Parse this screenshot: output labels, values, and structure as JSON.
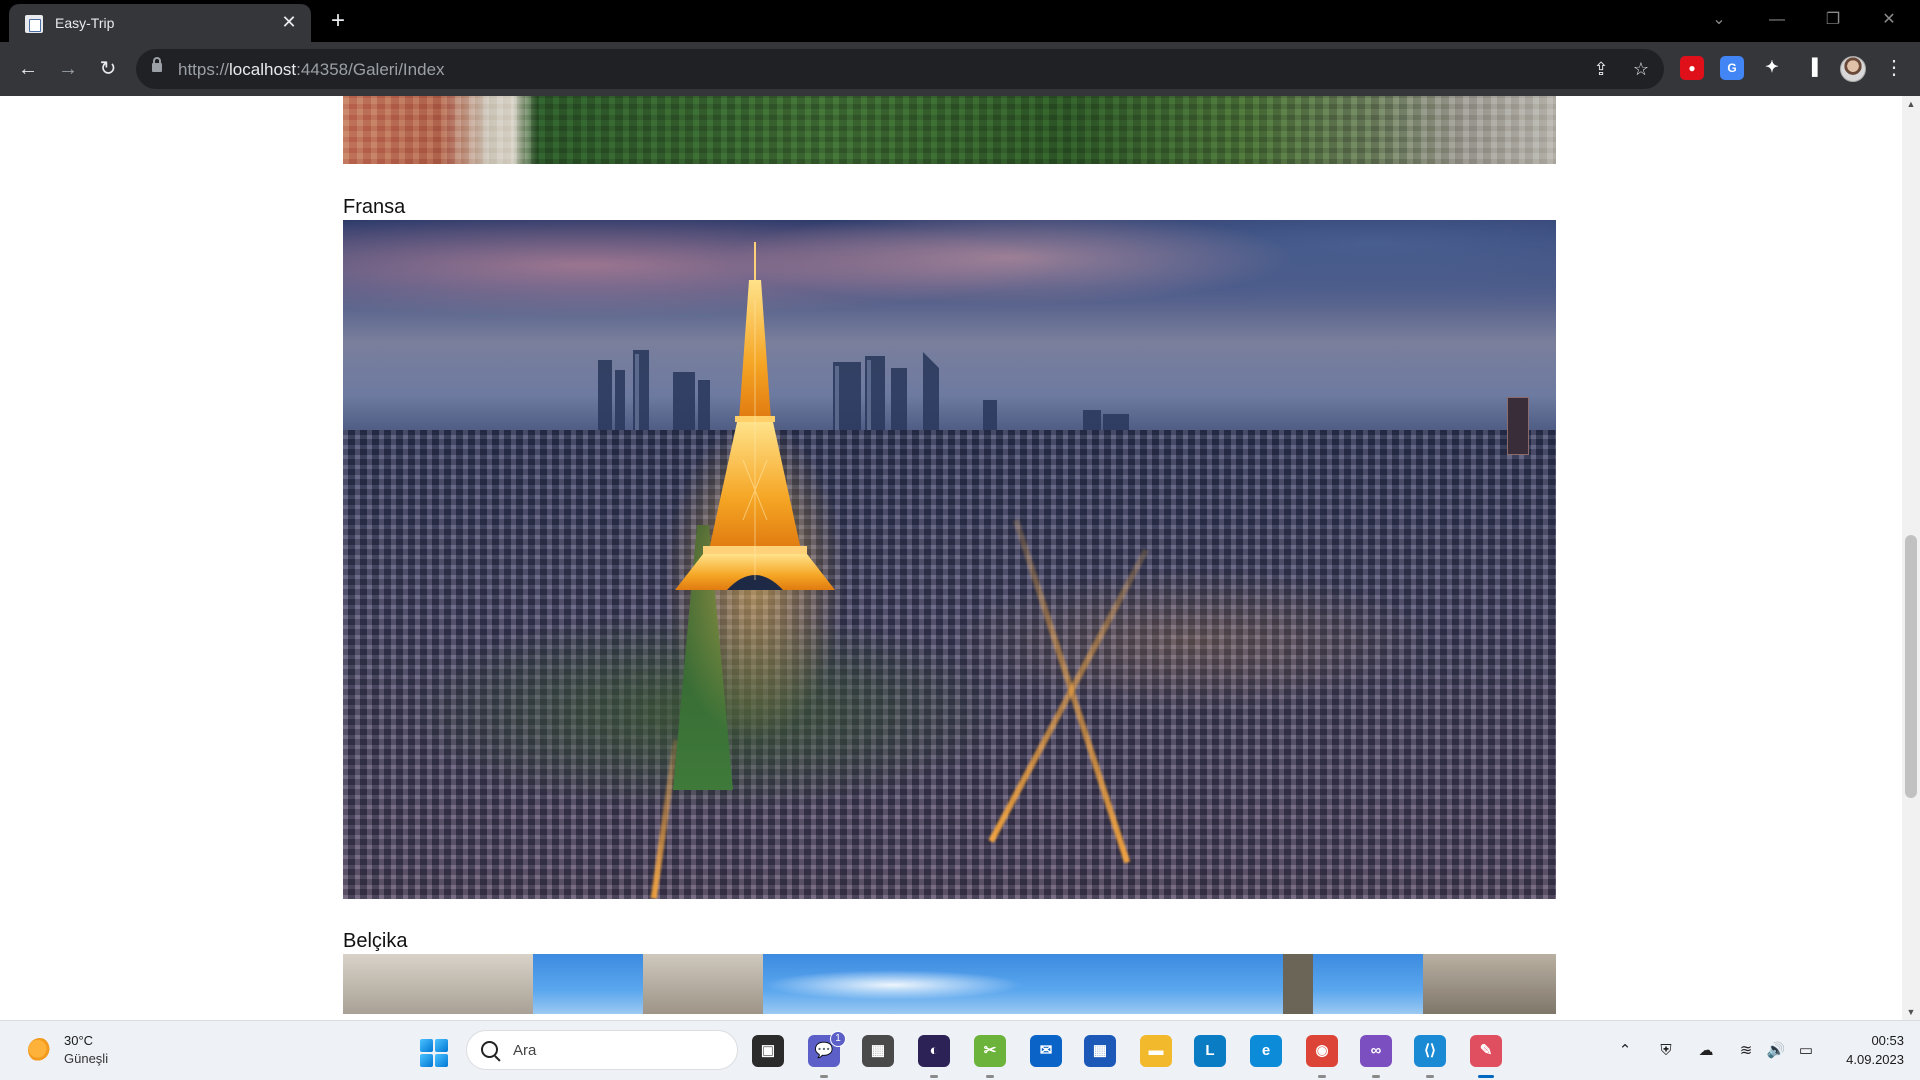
{
  "browser": {
    "tab_title": "Easy-Trip",
    "tab_close": "✕",
    "new_tab": "+",
    "url_scheme": "https://",
    "url_host": "localhost",
    "url_path": ":44358/Galeri/Index"
  },
  "toolbar": {
    "back": "←",
    "forward": "→",
    "reload": "↻",
    "share": "⇪",
    "bookmark": "☆",
    "menu": "⋮"
  },
  "window": {
    "dropdown": "⌄",
    "minimize": "—",
    "restore": "❐",
    "close": "✕"
  },
  "extensions": [
    {
      "icon": "adblock-icon",
      "glyph": "●",
      "color": "#e0101a"
    },
    {
      "icon": "translate-icon",
      "glyph": "G",
      "color": "#4285f4"
    },
    {
      "icon": "puzzle-icon",
      "glyph": "✦",
      "color": "#35363a"
    },
    {
      "icon": "sidepanel-icon",
      "glyph": "▐",
      "color": "#35363a"
    }
  ],
  "gallery": [
    {
      "caption": "",
      "image": "istanbul-aerial-photo"
    },
    {
      "caption": "Fransa",
      "image": "paris-eiffel-tower-photo"
    },
    {
      "caption": "Belçika",
      "image": "brussels-grand-place-photo"
    }
  ],
  "taskbar": {
    "weather_temp": "30°C",
    "weather_desc": "Güneşli",
    "search_placeholder": "Ara",
    "apps": [
      {
        "name": "file-explorer-dark-icon",
        "glyph": "▣",
        "color": "#2b2b2b"
      },
      {
        "name": "teams-chat-icon",
        "glyph": "💬",
        "color": "#5b5fc7",
        "badge": "1"
      },
      {
        "name": "calculator-icon",
        "glyph": "▦",
        "color": "#4a4a4a"
      },
      {
        "name": "eclipse-icon",
        "glyph": "◐",
        "color": "#2c2255"
      },
      {
        "name": "snipping-tool-icon",
        "glyph": "✂",
        "color": "#6bb33a"
      },
      {
        "name": "mail-icon",
        "glyph": "✉",
        "color": "#0a64c8"
      },
      {
        "name": "store-icon",
        "glyph": "▦",
        "color": "#1b58b8"
      },
      {
        "name": "folder-icon",
        "glyph": "▬",
        "color": "#f2b92c"
      },
      {
        "name": "l-app-icon",
        "glyph": "L",
        "color": "#0a7cc4"
      },
      {
        "name": "edge-icon",
        "glyph": "e",
        "color": "#0c8bd8"
      },
      {
        "name": "chrome-icon",
        "glyph": "◉",
        "color": "#db4437"
      },
      {
        "name": "visual-studio-icon",
        "glyph": "∞",
        "color": "#7b4fbf"
      },
      {
        "name": "vscode-icon",
        "glyph": "⟨⟩",
        "color": "#1a8ad4"
      },
      {
        "name": "paint-tool-icon",
        "glyph": "✎",
        "color": "#e04f5f"
      }
    ],
    "tray": [
      {
        "name": "chevron-up-icon",
        "glyph": "⌃"
      },
      {
        "name": "defender-icon",
        "glyph": "⛨"
      },
      {
        "name": "onedrive-icon",
        "glyph": "☁"
      },
      {
        "name": "wifi-icon",
        "glyph": "≋"
      },
      {
        "name": "volume-icon",
        "glyph": "🔊"
      },
      {
        "name": "battery-icon",
        "glyph": "▭"
      }
    ],
    "time": "00:53",
    "date": "4.09.2023"
  },
  "scrollbar": {
    "position_fraction": 0.52,
    "visible_fraction": 0.28
  }
}
